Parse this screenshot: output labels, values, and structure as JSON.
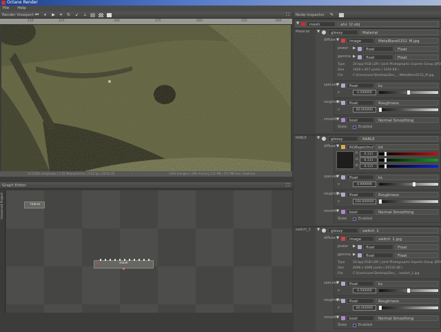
{
  "window": {
    "title": "Octane Render"
  },
  "menu": [
    "File",
    "Help"
  ],
  "viewport": {
    "title": "Render Viewport",
    "ruler": [
      "150",
      "225",
      "300",
      "375",
      "450",
      "525",
      "600"
    ],
    "status_left": "14.5/300 samples/px | 1.01 Msamples/sec | 0.02 fps | 00:01:35",
    "status_right": "3393 triangles | GPU memory 111 MB | 271 MB free | Realtime"
  },
  "graph": {
    "title": "Graph Editor",
    "side_tab": "Unnamed Project",
    "nodes": [
      {
        "label": "macro"
      },
      {
        "label": "mesh"
      }
    ]
  },
  "inspector": {
    "title": "Node Inspector",
    "root": {
      "type": "mesh",
      "name": "ahz_t2.obj"
    },
    "sections": [
      {
        "label": "Material",
        "type": "glossy",
        "name": "Material",
        "params": [
          {
            "label": "diffuse",
            "kind": "image",
            "type": "image",
            "name": "MetalBare0152_M.jpg",
            "sub": [
              {
                "label": "power",
                "type": "float",
                "name": "Float"
              },
              {
                "label": "gamma",
                "type": "float",
                "name": "Float"
              }
            ],
            "info": [
              {
                "k": "Type",
                "v": "24 bpp RGB LDR ( Joint Photographic Experts Group (JPEG) )"
              },
              {
                "k": "Size",
                "v": "1600 x 857 pixels ( 3244 KB )"
              },
              {
                "k": "File",
                "v": "C:\\Users\\user\\Desktop\\Dev_...\\MetalBare0152_M.jpg"
              }
            ]
          },
          {
            "label": "specular",
            "kind": "float",
            "type": "float",
            "name": "ks",
            "v": "v",
            "value": "0.500000",
            "fraction": 0.5
          },
          {
            "label": "roughness",
            "kind": "float",
            "type": "float",
            "name": "Roughness",
            "v": "v",
            "value": "80.000000",
            "fraction": 0.0
          },
          {
            "label": "smooth",
            "kind": "bool",
            "type": "bool",
            "name": "Normal Smoothing",
            "state": "State",
            "value": "Enabled"
          }
        ]
      },
      {
        "label": "RABLE",
        "type": "glossy",
        "name": "RABLE",
        "params": [
          {
            "label": "diffuse",
            "kind": "rgb",
            "type": "RGBspectrum",
            "name": "kd",
            "channels": [
              {
                "k": "R",
                "value": "0.111",
                "color": "#c01010"
              },
              {
                "k": "G",
                "value": "0.111",
                "color": "#10a020"
              },
              {
                "k": "B",
                "value": "0.111",
                "color": "#1020d0"
              }
            ]
          },
          {
            "label": "specular",
            "kind": "float",
            "type": "float",
            "name": "ks",
            "v": "v",
            "value": "0.999999",
            "fraction": 0.6
          },
          {
            "label": "roughness",
            "kind": "float",
            "type": "float",
            "name": "Roughness",
            "v": "v",
            "value": "100.000000",
            "fraction": 0.0
          },
          {
            "label": "smooth",
            "kind": "bool",
            "type": "bool",
            "name": "Normal Smoothing",
            "state": "State",
            "value": "Enabled"
          }
        ]
      },
      {
        "label": "switch_1",
        "type": "glossy",
        "name": "switch_1",
        "params": [
          {
            "label": "diffuse",
            "kind": "image",
            "type": "image",
            "name": "switch_1.jpg",
            "sub": [
              {
                "label": "power",
                "type": "float",
                "name": "Float"
              },
              {
                "label": "gamma",
                "type": "float",
                "name": "Float"
              }
            ],
            "info": [
              {
                "k": "Type",
                "v": "24 bpp RGB LDR ( Joint Photographic Experts Group (JPEG) )"
              },
              {
                "k": "Size",
                "v": "4096 x 4096 pixels ( 65532 KB )"
              },
              {
                "k": "File",
                "v": "C:\\Users\\user\\Desktop\\Dev_...\\switch_1.jpg"
              }
            ]
          },
          {
            "label": "specular",
            "kind": "float",
            "type": "float",
            "name": "ks",
            "v": "v",
            "value": "0.500000",
            "fraction": 0.5
          },
          {
            "label": "roughness",
            "kind": "float",
            "type": "float",
            "name": "Roughness",
            "v": "v",
            "value": "80.000000",
            "fraction": 0.0
          },
          {
            "label": "smooth",
            "kind": "bool",
            "type": "bool",
            "name": "Normal Smoothing",
            "state": "State",
            "value": "Enabled"
          }
        ]
      }
    ]
  }
}
